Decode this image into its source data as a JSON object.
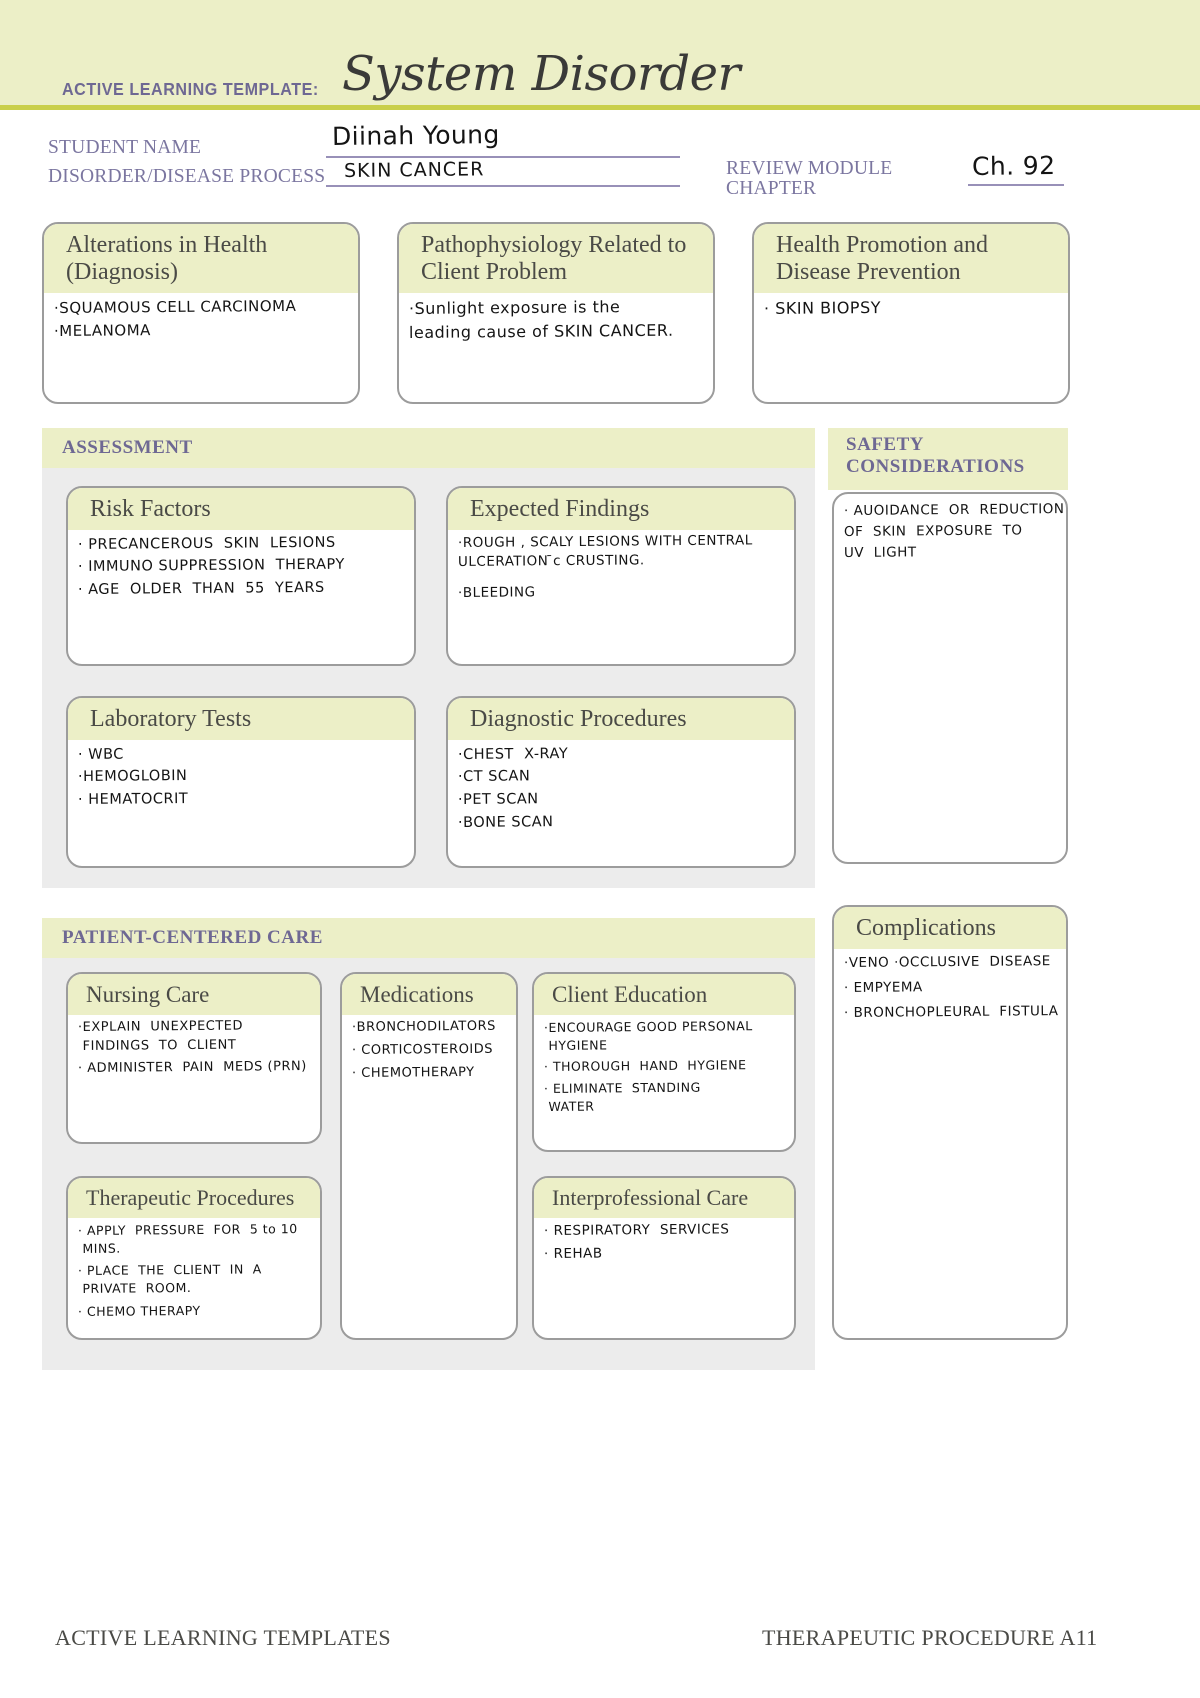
{
  "header": {
    "kicker": "ACTIVE LEARNING TEMPLATE:",
    "title": "System Disorder",
    "band_color": "#ecefc7",
    "accent_color": "#c9cf4a"
  },
  "fields": {
    "student_name_label": "STUDENT NAME",
    "student_name_value": "Diinah Young",
    "disorder_label": "DISORDER/DISEASE PROCESS",
    "disorder_value": "SKIN CANCER",
    "review_module_label_line1": "REVIEW MODULE",
    "review_module_label_line2": "CHAPTER",
    "review_module_value": "Ch. 92"
  },
  "top_boxes": [
    {
      "title": "Alterations in Health (Diagnosis)",
      "lines": [
        "·SQUAMOUS CELL CARCINOMA",
        "·MELANOMA"
      ]
    },
    {
      "title": "Pathophysiology Related to Client Problem",
      "lines": [
        "·Sunlight exposure is the",
        "leading cause of SKIN CANCER."
      ]
    },
    {
      "title": "Health Promotion and Disease Prevention",
      "lines": [
        "· SKIN BIOPSY"
      ]
    }
  ],
  "assessment": {
    "section_title": "ASSESSMENT",
    "boxes": [
      {
        "title": "Risk Factors",
        "lines": [
          "· PRECANCEROUS  SKIN  LESIONS",
          "· IMMUNO SUPPRESSION  THERAPY",
          "· AGE  OLDER  THAN  55  YEARS"
        ]
      },
      {
        "title": "Expected Findings",
        "lines": [
          "·ROUGH , SCALY LESIONS WITH CENTRAL",
          "ULCERATION ̄c CRUSTING.",
          "",
          "·BLEEDING"
        ]
      },
      {
        "title": "Laboratory Tests",
        "lines": [
          "· WBC",
          "·HEMOGLOBIN",
          "· HEMATOCRIT"
        ]
      },
      {
        "title": "Diagnostic Procedures",
        "lines": [
          "·CHEST  X-RAY",
          "·CT SCAN",
          "·PET SCAN",
          "·BONE SCAN"
        ]
      }
    ]
  },
  "safety": {
    "section_title_line1": "SAFETY",
    "section_title_line2": "CONSIDERATIONS",
    "lines": [
      "· AUOIDANCE  OR  REDUCTION",
      "OF  SKIN  EXPOSURE  TO",
      "UV  LIGHT"
    ]
  },
  "patient_centered_care": {
    "section_title": "PATIENT-CENTERED CARE",
    "boxes": [
      {
        "title": "Nursing Care",
        "lines": [
          "·EXPLAIN  UNEXPECTED",
          " FINDINGS  TO  CLIENT",
          "· ADMINISTER  PAIN  MEDS (PRN)"
        ]
      },
      {
        "title": "Medications",
        "lines": [
          "·BRONCHODILATORS",
          "· CORTICOSTEROIDS",
          "· CHEMOTHERAPY"
        ]
      },
      {
        "title": "Client Education",
        "lines": [
          "·ENCOURAGE GOOD PERSONAL",
          " HYGIENE",
          "· THOROUGH  HAND  HYGIENE",
          "· ELIMINATE  STANDING",
          " WATER"
        ]
      },
      {
        "title": "Therapeutic Procedures",
        "lines": [
          "· APPLY  PRESSURE  FOR  5 to 10",
          " MINS.",
          "· PLACE  THE  CLIENT  IN  A",
          " PRIVATE  ROOM.",
          "· CHEMO THERAPY"
        ]
      },
      {
        "title": "Interprofessional Care",
        "lines": [
          "· RESPIRATORY  SERVICES",
          "· REHAB"
        ]
      }
    ]
  },
  "complications": {
    "title": "Complications",
    "lines": [
      "·VENO ·OCCLUSIVE  DISEASE",
      "· EMPYEMA",
      "· BRONCHOPLEURAL  FISTULA"
    ]
  },
  "footer": {
    "left": "ACTIVE LEARNING TEMPLATES",
    "right": "THERAPEUTIC PROCEDURE   A11"
  }
}
